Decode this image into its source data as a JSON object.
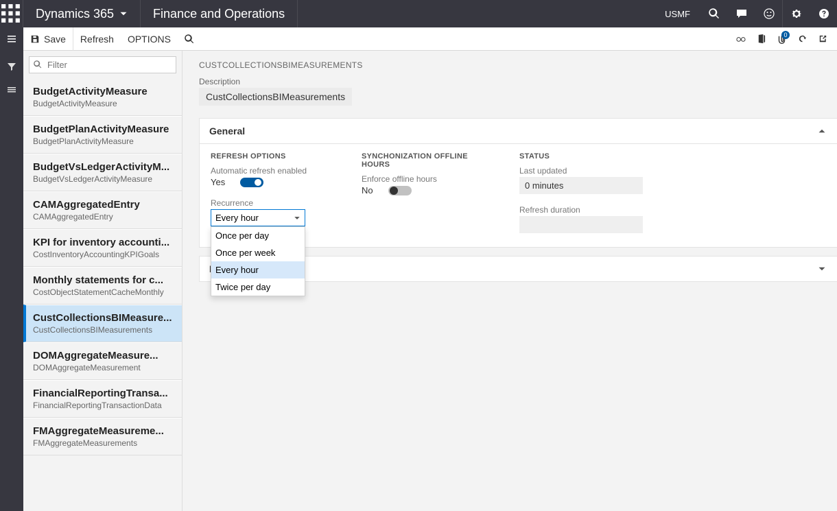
{
  "topbar": {
    "brand": "Dynamics 365",
    "module": "Finance and Operations",
    "entity": "USMF"
  },
  "actionbar": {
    "save": "Save",
    "refresh": "Refresh",
    "options": "OPTIONS"
  },
  "sidebar": {
    "filter_placeholder": "Filter",
    "items": [
      {
        "title": "BudgetActivityMeasure",
        "sub": "BudgetActivityMeasure"
      },
      {
        "title": "BudgetPlanActivityMeasure",
        "sub": "BudgetPlanActivityMeasure"
      },
      {
        "title": "BudgetVsLedgerActivityM...",
        "sub": "BudgetVsLedgerActivityMeasure"
      },
      {
        "title": "CAMAggregatedEntry",
        "sub": "CAMAggregatedEntry"
      },
      {
        "title": "KPI for inventory accounti...",
        "sub": "CostInventoryAccountingKPIGoals"
      },
      {
        "title": "Monthly statements for c...",
        "sub": "CostObjectStatementCacheMonthly"
      },
      {
        "title": "CustCollectionsBIMeasure...",
        "sub": "CustCollectionsBIMeasurements"
      },
      {
        "title": "DOMAggregateMeasure...",
        "sub": "DOMAggregateMeasurement"
      },
      {
        "title": "FinancialReportingTransa...",
        "sub": "FinancialReportingTransactionData"
      },
      {
        "title": "FMAggregateMeasureme...",
        "sub": "FMAggregateMeasurements"
      }
    ],
    "selected_index": 6
  },
  "content": {
    "crumb": "CUSTCOLLECTIONSBIMEASUREMENTS",
    "description_label": "Description",
    "description_value": "CustCollectionsBIMeasurements",
    "panels": {
      "general": {
        "title": "General",
        "refresh_options": {
          "header": "REFRESH OPTIONS",
          "auto_label": "Automatic refresh enabled",
          "auto_value": "Yes",
          "recurrence_label": "Recurrence",
          "recurrence_value": "Every hour",
          "recurrence_options": [
            "Once per day",
            "Once per week",
            "Every hour",
            "Twice per day"
          ]
        },
        "sync": {
          "header": "SYNCHONIZATION OFFLINE HOURS",
          "enforce_label": "Enforce offline hours",
          "enforce_value": "No"
        },
        "status": {
          "header": "STATUS",
          "last_updated_label": "Last updated",
          "last_updated_value": "0 minutes",
          "refresh_duration_label": "Refresh duration",
          "refresh_duration_value": ""
        }
      },
      "r_title": "R"
    }
  },
  "badge": {
    "count": "0"
  }
}
